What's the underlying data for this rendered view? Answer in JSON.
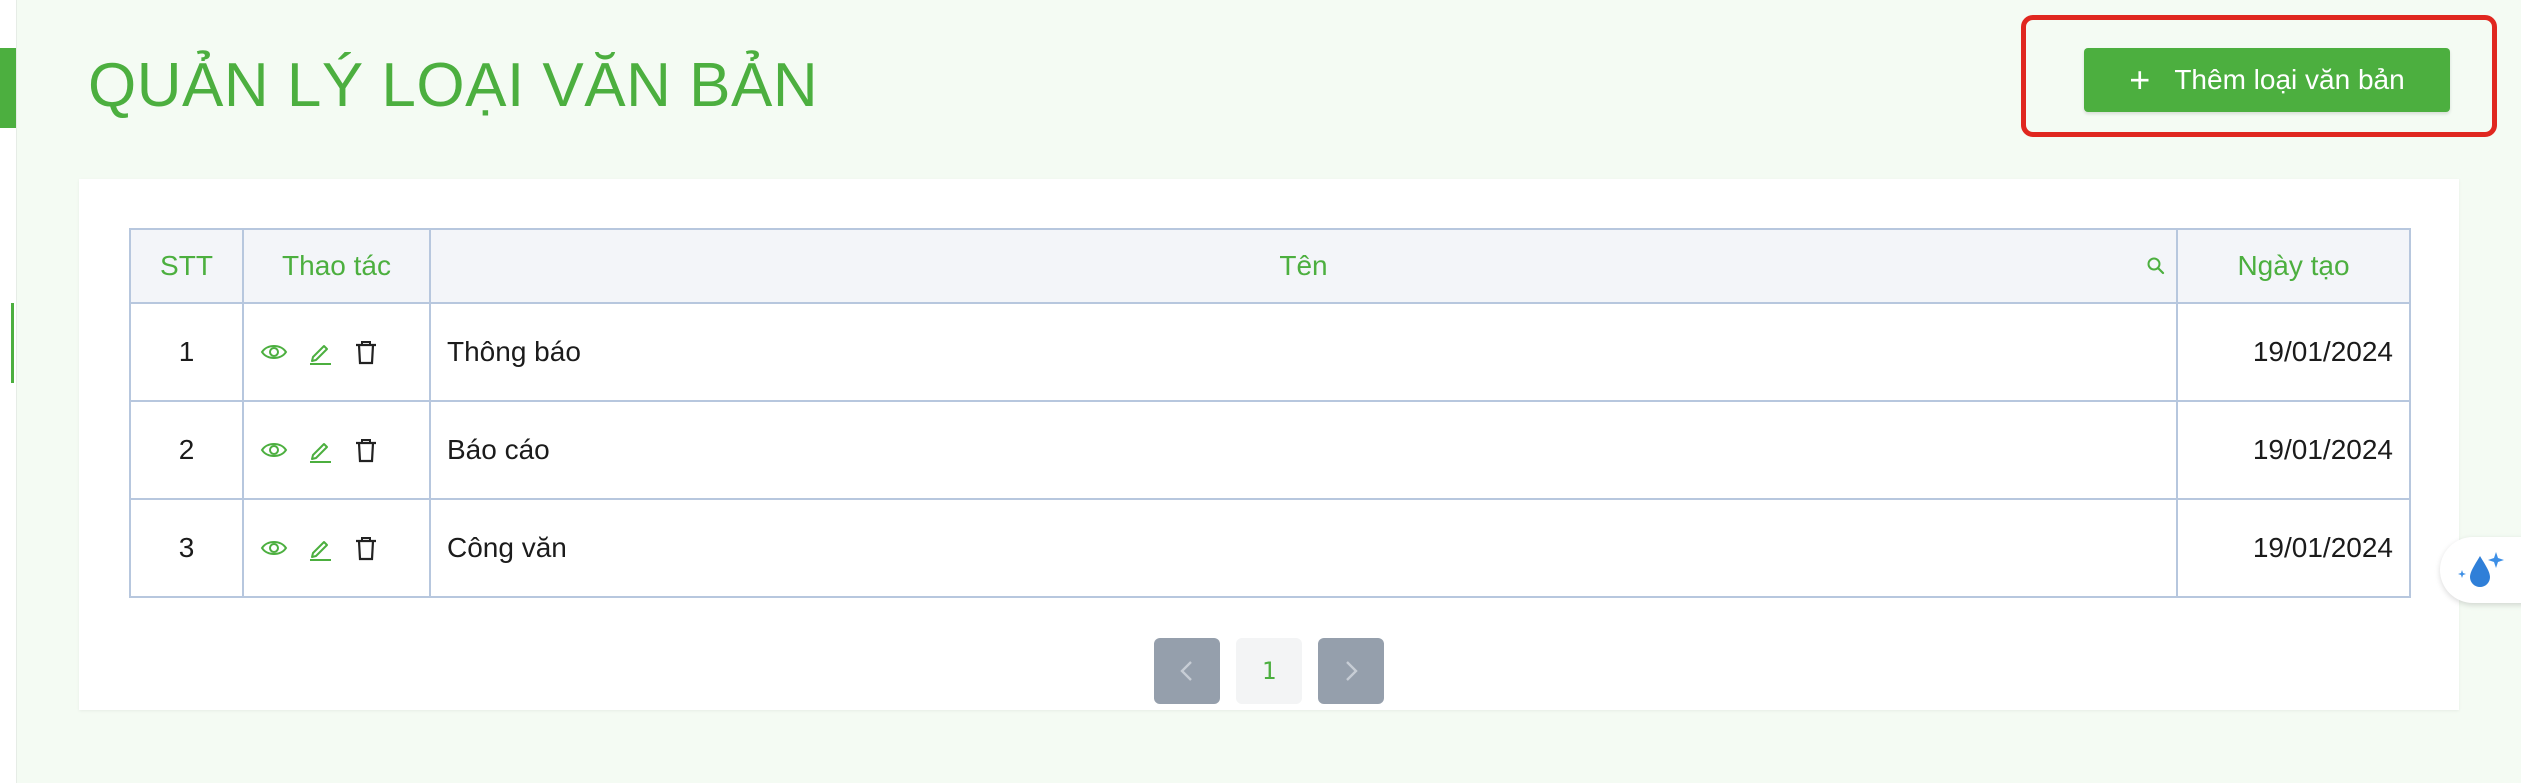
{
  "header": {
    "title": "QUẢN LÝ LOẠI VĂN BẢN",
    "add_button_label": "Thêm loại văn bản"
  },
  "table": {
    "columns": [
      "STT",
      "Thao tác",
      "Tên",
      "Ngày tạo"
    ],
    "rows": [
      {
        "stt": "1",
        "name": "Thông báo",
        "created": "19/01/2024"
      },
      {
        "stt": "2",
        "name": "Báo cáo",
        "created": "19/01/2024"
      },
      {
        "stt": "3",
        "name": "Công văn",
        "created": "19/01/2024"
      }
    ],
    "action_icons": [
      "eye-icon",
      "edit-icon",
      "trash-icon"
    ]
  },
  "pagination": {
    "current_page": "1"
  },
  "colors": {
    "accent": "#4caf3f",
    "highlight": "#e0271f",
    "header_bg": "#f3f5f9",
    "border": "#b7c7de",
    "nav_button": "#959fac"
  }
}
